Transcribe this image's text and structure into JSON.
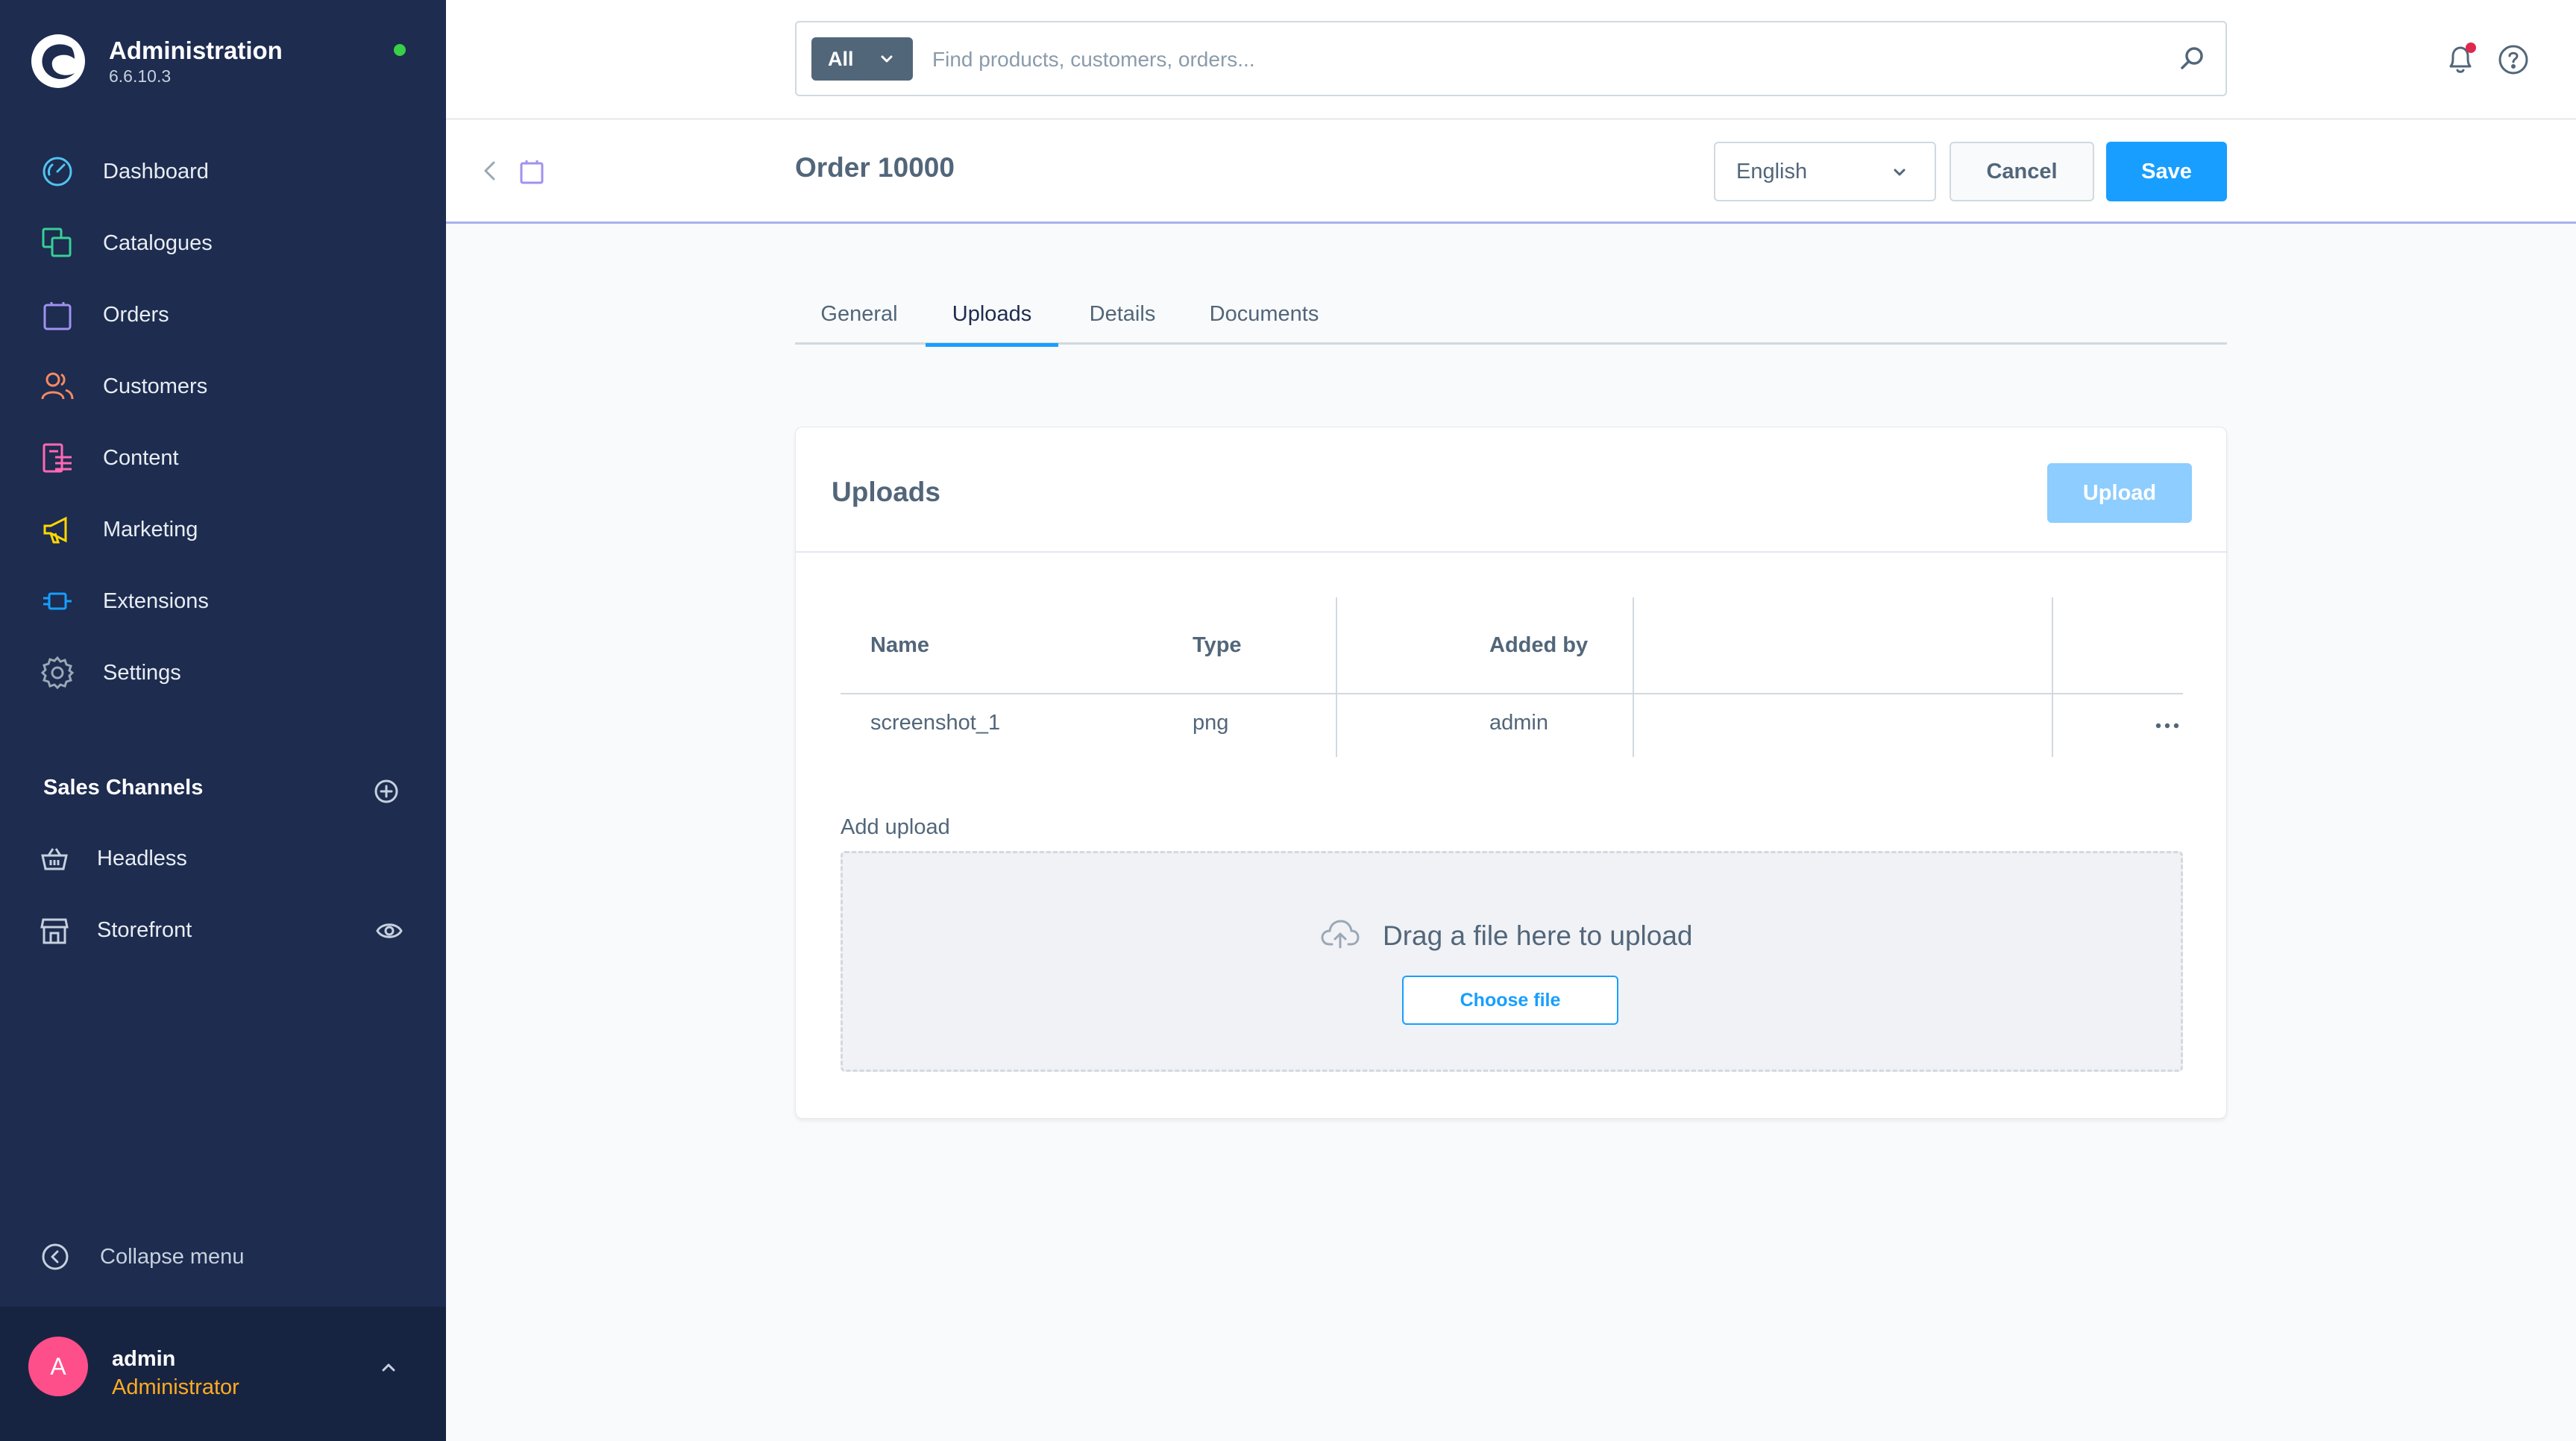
{
  "app": {
    "title": "Administration",
    "version": "6.6.10.3"
  },
  "sidebar": {
    "items": [
      {
        "label": "Dashboard",
        "icon": "dashboard-icon",
        "color": "#52c3f1"
      },
      {
        "label": "Catalogues",
        "icon": "catalogues-icon",
        "color": "#37d097"
      },
      {
        "label": "Orders",
        "icon": "orders-icon",
        "color": "#a092f0"
      },
      {
        "label": "Customers",
        "icon": "customers-icon",
        "color": "#f88962"
      },
      {
        "label": "Content",
        "icon": "content-icon",
        "color": "#ff68b4"
      },
      {
        "label": "Marketing",
        "icon": "marketing-icon",
        "color": "#ffd700"
      },
      {
        "label": "Extensions",
        "icon": "extensions-icon",
        "color": "#189eff"
      },
      {
        "label": "Settings",
        "icon": "settings-icon",
        "color": "#9aa8b5"
      }
    ],
    "sales_channels": {
      "title": "Sales Channels",
      "items": [
        {
          "label": "Headless",
          "icon": "basket-icon"
        },
        {
          "label": "Storefront",
          "icon": "storefront-icon"
        }
      ]
    },
    "collapse_label": "Collapse menu",
    "user": {
      "initial": "A",
      "name": "admin",
      "role": "Administrator"
    }
  },
  "search": {
    "type_label": "All",
    "placeholder": "Find products, customers, orders..."
  },
  "smartbar": {
    "title": "Order 10000",
    "language": "English",
    "cancel_label": "Cancel",
    "save_label": "Save"
  },
  "tabs": [
    {
      "label": "General",
      "active": false
    },
    {
      "label": "Uploads",
      "active": true
    },
    {
      "label": "Details",
      "active": false
    },
    {
      "label": "Documents",
      "active": false
    }
  ],
  "uploads_card": {
    "title": "Uploads",
    "upload_button": "Upload",
    "columns": [
      "Name",
      "Type",
      "Added by"
    ],
    "rows": [
      {
        "name": "screenshot_1",
        "type": "png",
        "added_by": "admin"
      }
    ],
    "add_upload_label": "Add upload",
    "dropzone_text": "Drag a file here to upload",
    "choose_file_label": "Choose file"
  },
  "colors": {
    "sidebar_bg": "#1d2c4f",
    "primary": "#189eff",
    "online_status": "#37d046",
    "notification_dot": "#de294c",
    "avatar": "#ff4f8b",
    "role_text": "#ffab22"
  }
}
